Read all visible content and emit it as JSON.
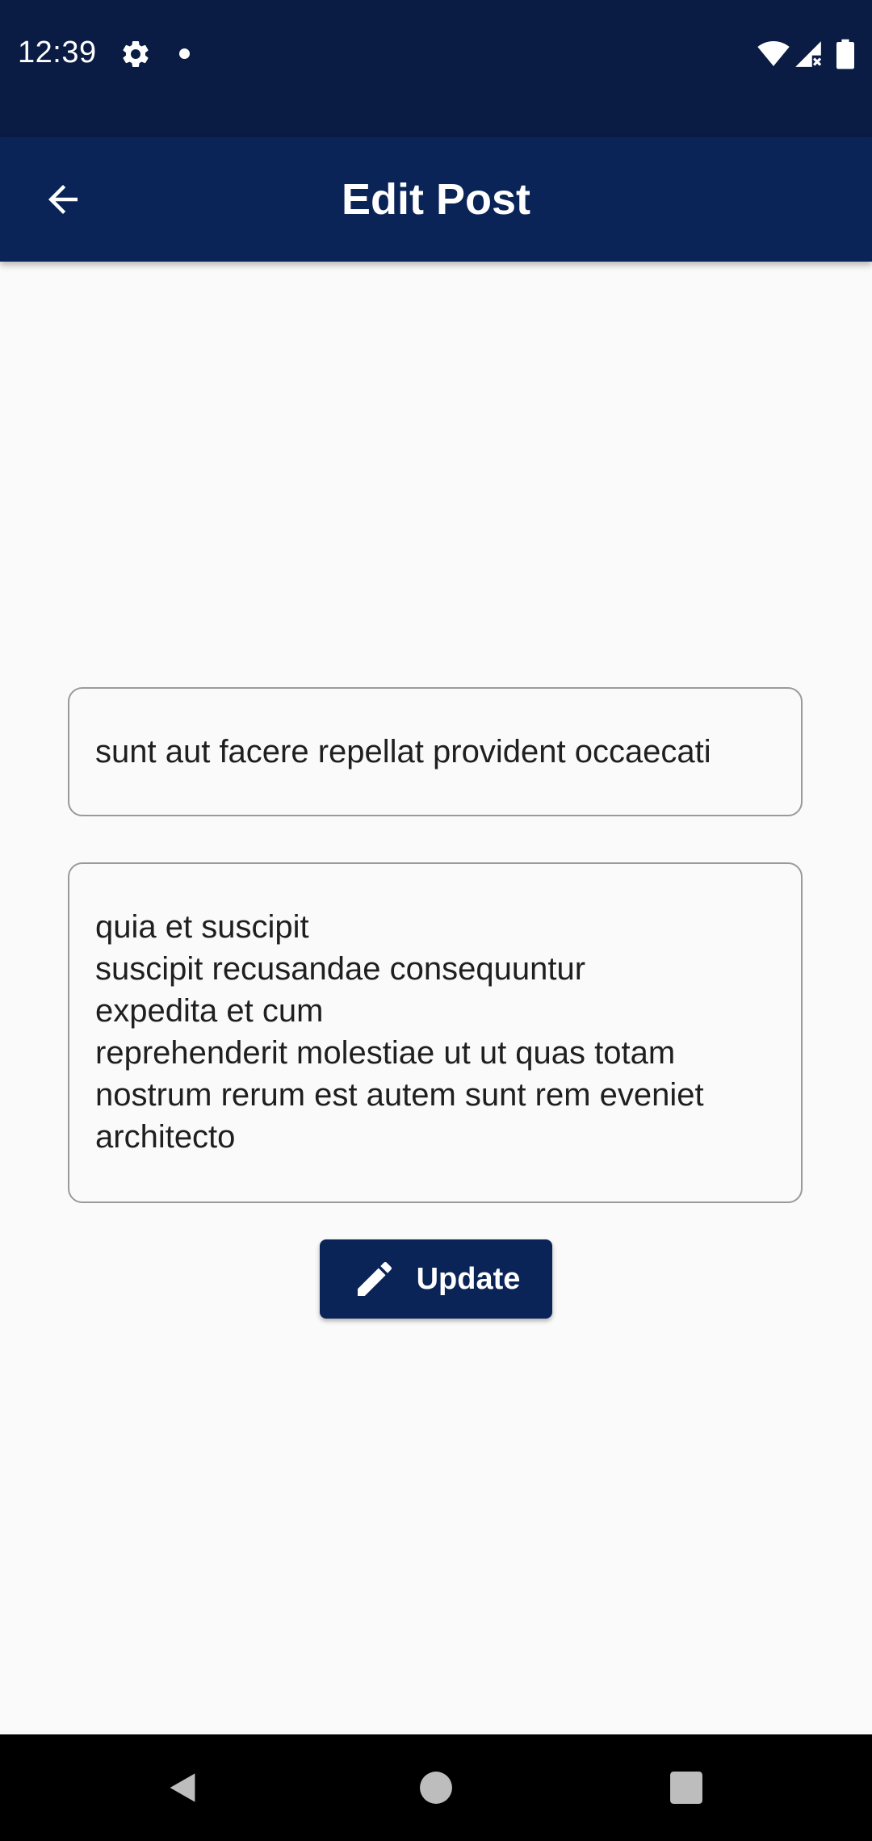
{
  "status_bar": {
    "time": "12:39",
    "icons": [
      "gear-icon",
      "notification-dot-icon",
      "wifi-icon",
      "signal-icon",
      "battery-icon"
    ]
  },
  "app_bar": {
    "title": "Edit Post",
    "back_icon": "arrow-back-icon"
  },
  "form": {
    "title_value": "sunt aut facere repellat provident occaecati",
    "body_value": "quia et suscipit\nsuscipit recusandae consequuntur\nexpedita et cum\nreprehenderit molestiae ut ut quas totam\nnostrum rerum est autem sunt rem eveniet\narchitecto",
    "update_button": {
      "label": "Update",
      "icon": "pencil-icon"
    }
  },
  "nav_bar": {
    "icons": [
      "nav-back-icon",
      "nav-home-icon",
      "nav-recents-icon"
    ]
  },
  "colors": {
    "status_bar": "#0a1c44",
    "app_bar": "#0b2458",
    "background": "#fafafa",
    "field_border": "#9a9a9a",
    "text": "#1f1f1f",
    "nav_bar": "#000000"
  }
}
